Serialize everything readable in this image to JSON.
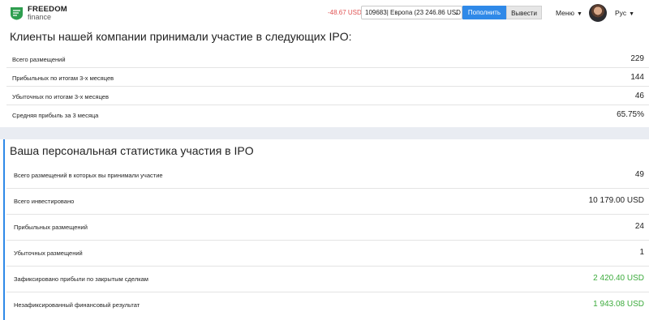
{
  "header": {
    "logo_line1": "FREEDOM",
    "logo_line2": "finance",
    "balance": "-48.67 USD",
    "account": "109683| Европа (23 246.86 USD",
    "deposit_label": "Пополнить",
    "withdraw_label": "Вывести",
    "menu_label": "Меню",
    "language": "Рус"
  },
  "company": {
    "title": "Клиенты нашей компании принимали участие в следующих IPO:",
    "rows": [
      {
        "label": "Всего размещений",
        "value": "229"
      },
      {
        "label": "Прибыльных по итогам 3-х месяцев",
        "value": "144"
      },
      {
        "label": "Убыточных по итогам 3-х месяцев",
        "value": "46"
      },
      {
        "label": "Средняя прибыль за 3 месяца",
        "value": "65.75%"
      }
    ]
  },
  "personal": {
    "title": "Ваша персональная статистика участия в IPO",
    "rows": [
      {
        "label": "Всего размещений в которых вы принимали участие",
        "value": "49"
      },
      {
        "label": "Всего инвестировано",
        "value": "10 179.00 USD"
      },
      {
        "label": "Прибыльных размещений",
        "value": "24"
      },
      {
        "label": "Убыточных размещений",
        "value": "1"
      },
      {
        "label": "Зафиксировано прибыли по закрытым сделкам",
        "value": "2 420.40 USD"
      },
      {
        "label": "Незафиксированный финансовый результат",
        "value": "1 943.08 USD"
      }
    ]
  },
  "colors": {
    "accent": "#2f89e8",
    "positive": "#3cab3c",
    "negative": "#e05252",
    "logo_green": "#2e9e4f"
  },
  "icons": [
    "freedom-logo-icon",
    "chevron-down-icon",
    "menu-caret-icon",
    "language-caret-icon",
    "avatar"
  ]
}
